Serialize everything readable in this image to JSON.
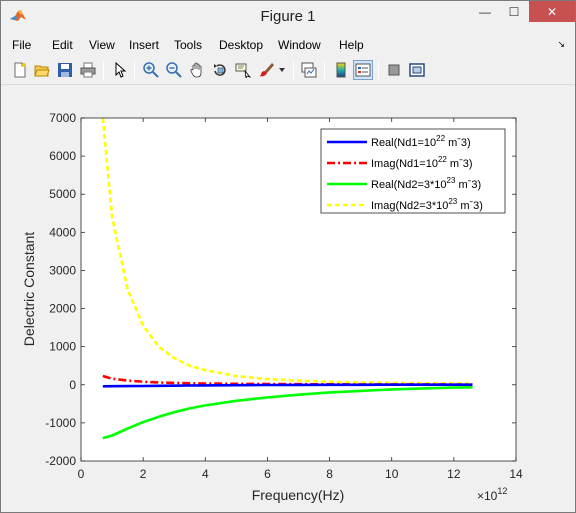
{
  "window": {
    "title": "Figure 1",
    "min_glyph": "—",
    "max_glyph": "☐",
    "close_glyph": "✕"
  },
  "menu": {
    "items": [
      "File",
      "Edit",
      "View",
      "Insert",
      "Tools",
      "Desktop",
      "Window",
      "Help"
    ],
    "dock_glyph": "↘"
  },
  "toolbar": {
    "buttons": [
      "new-figure",
      "open-file",
      "save-figure",
      "print-figure",
      "edit-plot",
      "zoom-in",
      "zoom-out",
      "pan",
      "rotate-3d",
      "data-cursor",
      "brush",
      "brush-dropdown",
      "link-plot",
      "insert-colorbar",
      "insert-legend",
      "hide-plot-tools",
      "show-plot-tools"
    ]
  },
  "colors": {
    "real1": "#0000ff",
    "imag1": "#ff0000",
    "real2": "#00ff00",
    "imag2": "#ffff00"
  },
  "chart_data": {
    "type": "line",
    "xlabel": "Frequency(Hz)",
    "ylabel": "Delectric Constant",
    "x_exponent_base": "×10",
    "x_exponent": "12",
    "xlim": [
      0,
      14
    ],
    "ylim": [
      -2000,
      7000
    ],
    "xticks": [
      "0",
      "2",
      "4",
      "6",
      "8",
      "10",
      "12",
      "14"
    ],
    "yticks": [
      "-2000",
      "-1000",
      "0",
      "1000",
      "2000",
      "3000",
      "4000",
      "5000",
      "6000",
      "7000"
    ],
    "grid": false,
    "legend_position": "top-right",
    "x": [
      0.7,
      1,
      1.5,
      2,
      2.5,
      3,
      3.5,
      4,
      5,
      6,
      7,
      8,
      9,
      10,
      11,
      12,
      12.6
    ],
    "series": [
      {
        "name_prefix": "Real(Nd1=10",
        "name_exp": "22",
        "name_suffix": " mˉ3)",
        "color": "#0000ff",
        "style": "solid",
        "values": [
          -40,
          -38,
          -35,
          -32,
          -28,
          -24,
          -20,
          -16,
          -10,
          -6,
          -3,
          -1,
          0,
          1,
          2,
          2,
          2
        ]
      },
      {
        "name_prefix": "Imag(Nd1=10",
        "name_exp": "22",
        "name_suffix": " mˉ3)",
        "color": "#ff0000",
        "style": "dashdot",
        "values": [
          230,
          160,
          110,
          80,
          60,
          48,
          40,
          33,
          25,
          20,
          16,
          13,
          11,
          10,
          9,
          8,
          8
        ]
      },
      {
        "name_prefix": "Real(Nd2=3*10",
        "name_exp": "23",
        "name_suffix": " mˉ3)",
        "color": "#00ff00",
        "style": "solid",
        "values": [
          -1400,
          -1330,
          -1150,
          -980,
          -840,
          -720,
          -620,
          -540,
          -420,
          -330,
          -260,
          -200,
          -160,
          -120,
          -95,
          -75,
          -65
        ]
      },
      {
        "name_prefix": "Imag(Nd2=3*10",
        "name_exp": "23",
        "name_suffix": " mˉ3)",
        "color": "#ffff00",
        "style": "dashed",
        "values": [
          7000,
          4400,
          2500,
          1550,
          1000,
          700,
          500,
          380,
          230,
          150,
          110,
          80,
          60,
          50,
          40,
          35,
          30
        ]
      }
    ]
  }
}
